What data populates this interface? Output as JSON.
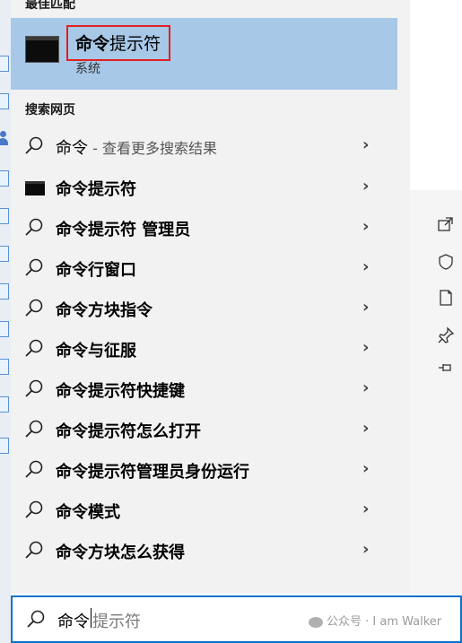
{
  "best_match": {
    "header": "最佳匹配",
    "title_bold": "命令",
    "title_rest": "提示符",
    "subtitle": "系统",
    "icon": "command-prompt-icon"
  },
  "web_section": {
    "header": "搜索网页"
  },
  "results": [
    {
      "bold": "",
      "plain": "命令",
      "hint": " - 查看更多搜索结果",
      "icon": "search-icon"
    },
    {
      "bold": "命令提示符",
      "plain": "",
      "hint": "",
      "icon": "command-prompt-icon"
    },
    {
      "bold": "命令提示符 管理员",
      "plain": "",
      "hint": "",
      "icon": "search-icon"
    },
    {
      "bold": "命令行窗口",
      "plain": "",
      "hint": "",
      "icon": "search-icon"
    },
    {
      "bold": "命令方块指令",
      "plain": "",
      "hint": "",
      "icon": "search-icon"
    },
    {
      "bold": "命令与征服",
      "plain": "",
      "hint": "",
      "icon": "search-icon"
    },
    {
      "bold": "命令提示符快捷键",
      "plain": "",
      "hint": "",
      "icon": "search-icon"
    },
    {
      "bold": "命令提示符怎么打开",
      "plain": "",
      "hint": "",
      "icon": "search-icon"
    },
    {
      "bold": "命令提示符管理员身份运行",
      "plain": "",
      "hint": "",
      "icon": "search-icon"
    },
    {
      "bold": "命令模式",
      "plain": "",
      "hint": "",
      "icon": "search-icon"
    },
    {
      "bold": "命令方块怎么获得",
      "plain": "",
      "hint": "",
      "icon": "search-icon"
    }
  ],
  "chevron": "›",
  "right_actions": [
    "open-icon",
    "run-as-admin-icon",
    "open-file-location-icon",
    "pin-to-start-icon",
    "pin-to-taskbar-icon"
  ],
  "search": {
    "typed": "命令",
    "suggestion": "提示符",
    "watermark": "公众号 · I am Walker"
  },
  "colors": {
    "highlight_bg": "#a8c8e8",
    "accent": "#0a72c9",
    "outline": "#e02020"
  }
}
